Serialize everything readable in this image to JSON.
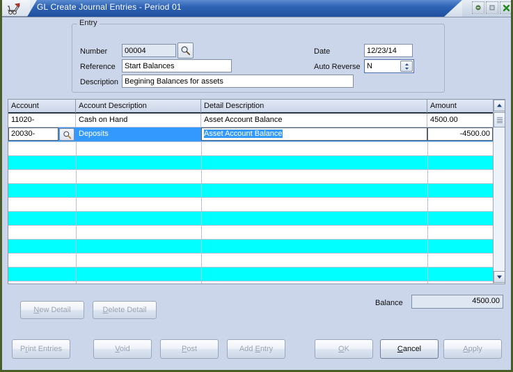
{
  "window": {
    "title": "GL Create Journal Entries - Period 01",
    "app_icon": "cart-icon",
    "controls": [
      {
        "name": "minimize-button",
        "glyph": "–"
      },
      {
        "name": "maximize-button",
        "glyph": "□"
      },
      {
        "name": "close-button",
        "glyph": "✕"
      }
    ],
    "accent_titlebar": "#2e63b5",
    "frame_border": "#4a5c28",
    "background": "#ccd6ea"
  },
  "entry": {
    "legend": "Entry",
    "number_label": "Number",
    "number_value": "00004",
    "number_lookup_icon": "magnifier-icon",
    "reference_label": "Reference",
    "reference_value": "Start Balances",
    "description_label": "Description",
    "description_value": "Begining Balances for assets",
    "date_label": "Date",
    "date_value": "12/23/14",
    "auto_reverse_label": "Auto Reverse",
    "auto_reverse_value": "N",
    "auto_reverse_spinner_icon": "spinner-updown-icon"
  },
  "grid": {
    "columns": [
      {
        "key": "account",
        "label": "Account"
      },
      {
        "key": "account_description",
        "label": "Account Description"
      },
      {
        "key": "detail_description",
        "label": "Detail Description"
      },
      {
        "key": "amount",
        "label": "Amount"
      }
    ],
    "rows": [
      {
        "account": "11020-",
        "account_description": "Cash on Hand",
        "detail_description": "Asset Account Balance",
        "amount": "4500.00",
        "state": "normal",
        "stripe": "white"
      },
      {
        "account": "20030-",
        "account_description": "Deposits",
        "detail_description": "Asset Account Balance",
        "amount": "-4500.00",
        "state": "selected-editing",
        "stripe": "selected",
        "lookup_icon": "magnifier-icon"
      },
      {
        "account": "",
        "account_description": "",
        "detail_description": "",
        "amount": "",
        "state": "empty",
        "stripe": "white"
      },
      {
        "account": "",
        "account_description": "",
        "detail_description": "",
        "amount": "",
        "state": "empty",
        "stripe": "cyan"
      },
      {
        "account": "",
        "account_description": "",
        "detail_description": "",
        "amount": "",
        "state": "empty",
        "stripe": "white"
      },
      {
        "account": "",
        "account_description": "",
        "detail_description": "",
        "amount": "",
        "state": "empty",
        "stripe": "cyan"
      },
      {
        "account": "",
        "account_description": "",
        "detail_description": "",
        "amount": "",
        "state": "empty",
        "stripe": "white"
      },
      {
        "account": "",
        "account_description": "",
        "detail_description": "",
        "amount": "",
        "state": "empty",
        "stripe": "cyan"
      },
      {
        "account": "",
        "account_description": "",
        "detail_description": "",
        "amount": "",
        "state": "empty",
        "stripe": "white"
      },
      {
        "account": "",
        "account_description": "",
        "detail_description": "",
        "amount": "",
        "state": "empty",
        "stripe": "cyan"
      },
      {
        "account": "",
        "account_description": "",
        "detail_description": "",
        "amount": "",
        "state": "empty",
        "stripe": "white"
      },
      {
        "account": "",
        "account_description": "",
        "detail_description": "",
        "amount": "",
        "state": "empty",
        "stripe": "cyan"
      },
      {
        "account": "",
        "account_description": "",
        "detail_description": "",
        "amount": "",
        "state": "empty",
        "stripe": "white"
      }
    ],
    "scrollbar": {
      "up_icon": "chevron-up-icon",
      "down_icon": "chevron-down-icon",
      "thumb_icon": "scroll-thumb"
    },
    "selected_row_index": 1,
    "row_stripe_color": "#00ffff",
    "selection_color": "#3399ff"
  },
  "detail_toolbar": {
    "new_detail": "New Detail",
    "new_detail_accel": "N",
    "delete_detail": "Delete Detail",
    "delete_detail_accel": "D",
    "new_detail_enabled": false,
    "delete_detail_enabled": false
  },
  "balance": {
    "label": "Balance",
    "value": "4500.00"
  },
  "footer_buttons": [
    {
      "name": "print-entries-button",
      "label": "Print Entries",
      "accel": "r",
      "enabled": false
    },
    {
      "name": "void-button",
      "label": "Void",
      "accel": "V",
      "enabled": false
    },
    {
      "name": "post-button",
      "label": "Post",
      "accel": "P",
      "enabled": false
    },
    {
      "name": "add-entry-button",
      "label": "Add Entry",
      "accel": "E",
      "enabled": false
    },
    {
      "name": "ok-button",
      "label": "OK",
      "accel": "O",
      "enabled": false
    },
    {
      "name": "cancel-button",
      "label": "Cancel",
      "accel": "C",
      "enabled": true
    },
    {
      "name": "apply-button",
      "label": "Apply",
      "accel": "A",
      "enabled": false
    }
  ]
}
